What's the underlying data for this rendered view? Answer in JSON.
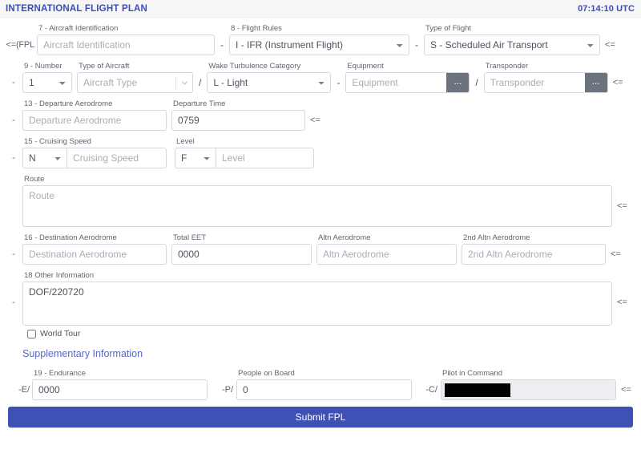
{
  "header": {
    "title": "INTERNATIONAL FLIGHT PLAN",
    "clock": "07:14:10 UTC"
  },
  "markers": {
    "fpl_open": "<=(FPL",
    "dash": "-",
    "arrow": "<=",
    "slash": "/",
    "hyphen_sep": "-",
    "dots": "...",
    "e_prefix": "-E/",
    "p_prefix": "-P/",
    "c_prefix": "-C/"
  },
  "fields": {
    "aircraft_identification": {
      "label": "7 - Aircraft Identification",
      "placeholder": "Aircraft Identification",
      "value": ""
    },
    "flight_rules": {
      "label": "8 - Flight Rules",
      "value": "I - IFR (Instrument Flight)",
      "options": [
        "I - IFR (Instrument Flight)"
      ]
    },
    "type_of_flight": {
      "label": "Type of Flight",
      "value": "S - Scheduled Air Transport",
      "options": [
        "S - Scheduled Air Transport"
      ]
    },
    "number": {
      "label": "9 - Number",
      "value": "1",
      "options": [
        "1"
      ]
    },
    "type_of_aircraft": {
      "label": "Type of Aircraft",
      "placeholder": "Aircraft Type",
      "value": ""
    },
    "wake_turbulence_category": {
      "label": "Wake Turbulence Category",
      "value": "L - Light",
      "options": [
        "L - Light"
      ]
    },
    "equipment": {
      "label": "Equipment",
      "placeholder": "Equipment",
      "value": ""
    },
    "transponder": {
      "label": "Transponder",
      "placeholder": "Transponder",
      "value": ""
    },
    "departure_aerodrome": {
      "label": "13 - Departure Aerodrome",
      "placeholder": "Departure Aerodrome",
      "value": ""
    },
    "departure_time": {
      "label": "Departure Time",
      "placeholder": "",
      "value": "0759"
    },
    "cruising_speed_unit": {
      "label": "15 - Cruising Speed",
      "value": "N",
      "options": [
        "N"
      ]
    },
    "cruising_speed": {
      "placeholder": "Cruising Speed",
      "value": ""
    },
    "level_unit": {
      "label": "Level",
      "value": "F",
      "options": [
        "F"
      ]
    },
    "level": {
      "placeholder": "Level",
      "value": ""
    },
    "route": {
      "label": "Route",
      "placeholder": "Route",
      "value": ""
    },
    "destination_aerodrome": {
      "label": "16 - Destination Aerodrome",
      "placeholder": "Destination Aerodrome",
      "value": ""
    },
    "total_eet": {
      "label": "Total EET",
      "placeholder": "",
      "value": "0000"
    },
    "altn_aerodrome": {
      "label": "Altn Aerodrome",
      "placeholder": "Altn Aerodrome",
      "value": ""
    },
    "second_altn_aerodrome": {
      "label": "2nd Altn Aerodrome",
      "placeholder": "2nd Altn Aerodrome",
      "value": ""
    },
    "other_information": {
      "label": "18 Other Information",
      "placeholder": "",
      "value": "DOF/220720"
    },
    "world_tour": {
      "label": "World Tour",
      "checked": false
    },
    "endurance": {
      "label": "19 - Endurance",
      "placeholder": "",
      "value": "0000"
    },
    "people_on_board": {
      "label": "People on Board",
      "placeholder": "",
      "value": "0"
    },
    "pilot_in_command": {
      "label": "Pilot in Command",
      "value": ""
    }
  },
  "sections": {
    "supplementary_information": "Supplementary Information"
  },
  "actions": {
    "submit": "Submit FPL"
  },
  "colors": {
    "accent": "#3f51b5",
    "title": "#3b4cb8",
    "link": "#5766c6",
    "header_bg": "#f6f6f7",
    "border": "#d5d8de",
    "dots_button": "#6c737f"
  }
}
